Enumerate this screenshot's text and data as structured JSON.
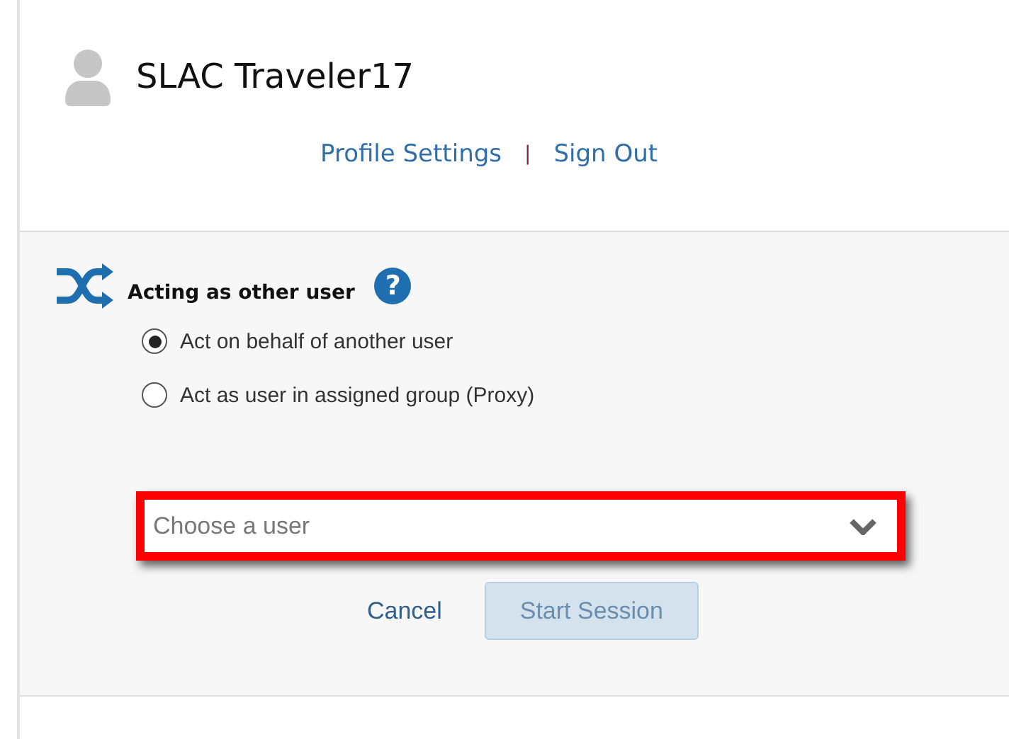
{
  "profile": {
    "name": "SLAC Traveler17",
    "links": [
      "Profile Settings",
      "Sign Out"
    ],
    "separator": "|"
  },
  "acting": {
    "title": "Acting as other user",
    "help": "?",
    "options": [
      {
        "label": "Act on behalf of another user",
        "selected": true
      },
      {
        "label": "Act as user in assigned group (Proxy)",
        "selected": false
      }
    ],
    "user_select": {
      "placeholder": "Choose a user",
      "highlighted": true
    },
    "buttons": [
      {
        "label": "Cancel",
        "kind": "link",
        "disabled": false
      },
      {
        "label": "Start Session",
        "kind": "primary",
        "disabled": true
      }
    ]
  }
}
